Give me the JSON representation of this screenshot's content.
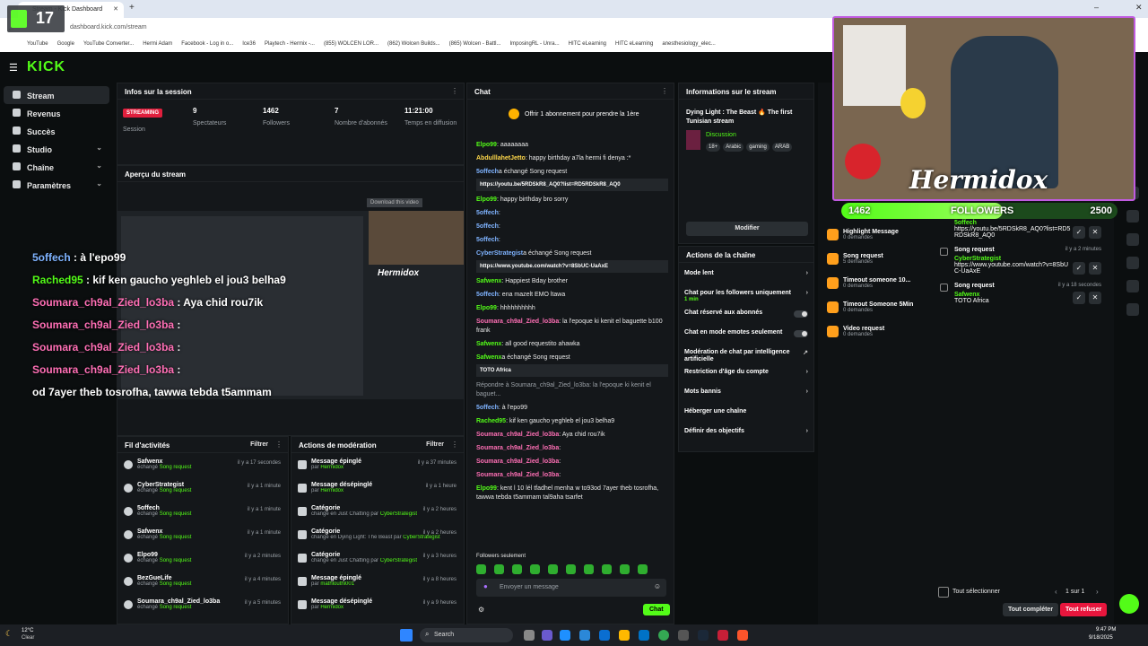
{
  "browser": {
    "tab_title": "Stream - Kick Dashboard",
    "url": "dashboard.kick.com/stream",
    "bookmarks": [
      "YouTube",
      "Google",
      "YouTube Converter...",
      "Hermi Adam",
      "Facebook - Log in o...",
      "Ice36",
      "Playtech - Hermix -...",
      "(855) WOLCEN LOR...",
      "(862) Wolcen Builds...",
      "(865) Wolcen - Battl...",
      "ImposingRL - Unra...",
      "HITC eLearning",
      "HITC eLearning",
      "anesthesiology_elec..."
    ]
  },
  "webcam_badge": "17",
  "sidebar": {
    "logo": "KICK",
    "items": [
      {
        "label": "Stream",
        "active": true
      },
      {
        "label": "Revenus"
      },
      {
        "label": "Succès"
      },
      {
        "label": "Studio",
        "chevron": true
      },
      {
        "label": "Chaîne",
        "chevron": true
      },
      {
        "label": "Paramètres",
        "chevron": true
      }
    ]
  },
  "session": {
    "title": "Infos sur la session",
    "status_badge": "STREAMING",
    "status_label": "Session",
    "stats": [
      {
        "value": "9",
        "label": "Spectateurs"
      },
      {
        "value": "1462",
        "label": "Followers"
      },
      {
        "value": "7",
        "label": "Nombre d'abonnés"
      },
      {
        "value": "11:21:00",
        "label": "Temps en diffusion"
      }
    ]
  },
  "preview": {
    "title": "Aperçu du stream",
    "download_label": "Download this video"
  },
  "overlay_chat": [
    {
      "user": "5offech",
      "text": ": à l'epo99",
      "color": "#7fb3ff"
    },
    {
      "user": "Rached95",
      "text": ": kif ken gaucho yeghleb el jou3 belha9",
      "color": "#53fc18"
    },
    {
      "user": "Soumara_ch9al_Zied_lo3ba",
      "text": ": Aya chid rou7ik",
      "color": "#ff6fb5"
    },
    {
      "user": "Soumara_ch9al_Zied_lo3ba",
      "text": ":",
      "color": "#ff6fb5"
    },
    {
      "user": "Soumara_ch9al_Zied_lo3ba",
      "text": ":",
      "color": "#ff6fb5"
    },
    {
      "user": "Soumara_ch9al_Zied_lo3ba",
      "text": ":",
      "color": "#ff6fb5"
    },
    {
      "user": "",
      "text": "od 7ayer theb tosrofha, tawwa tebda t5ammam",
      "color": "#ffffff"
    }
  ],
  "chat": {
    "title": "Chat",
    "sub_banner": "Offrir 1 abonnement pour prendre la 1ère",
    "messages": [
      {
        "user": "Elpo99",
        "text": ": aaaaaaaa",
        "color": "#53fc18"
      },
      {
        "user": "AbdulllahetJetto",
        "text": ": happy birthday a7la hermi fi denya :*",
        "color": "#ffd84a"
      },
      {
        "user": "5offech",
        "text": "a échangé Song request",
        "color": "#7fb3ff",
        "link": "https://youtu.be/5RDSkR8_AQ0?list=RD5RDSkR8_AQ0"
      },
      {
        "user": "Elpo99",
        "text": ": happy birthday bro sorry",
        "color": "#53fc18"
      },
      {
        "user": "5offech",
        "text": ":",
        "color": "#7fb3ff"
      },
      {
        "user": "5offech",
        "text": ":",
        "color": "#7fb3ff"
      },
      {
        "user": "5offech",
        "text": ":",
        "color": "#7fb3ff"
      },
      {
        "user": "CyberStrategist",
        "text": "a échangé Song request",
        "color": "#7fb3ff",
        "link": "https://www.youtube.com/watch?v=8SbUC-UaAxE"
      },
      {
        "user": "Safwenx",
        "text": ": Happiest Bday brother",
        "color": "#53fc18"
      },
      {
        "user": "5offech",
        "text": ": ena mazelt EMO ltawa",
        "color": "#7fb3ff"
      },
      {
        "user": "Elpo99",
        "text": ": hhhhhhhhhh",
        "color": "#53fc18"
      },
      {
        "user": "Soumara_ch9al_Zied_lo3ba",
        "text": ": la l'epoque ki kenit el baguette b100 frank",
        "color": "#ff6fb5"
      },
      {
        "user": "Safwenx",
        "text": ": all good requestito ahawka",
        "color": "#53fc18"
      },
      {
        "user": "Safwenx",
        "text": "a échangé Song request",
        "color": "#53fc18",
        "link": "TOTO Africa"
      },
      {
        "user": "",
        "text": "Répondre à Soumara_ch9al_Zied_lo3ba: la l'epoque ki kenit el baguet...",
        "color": "#9aa0a6"
      },
      {
        "user": "5offech",
        "text": ": à l'epo99",
        "color": "#7fb3ff"
      },
      {
        "user": "Rached95",
        "text": ": kif ken gaucho yeghleb el jou3 belha9",
        "color": "#53fc18"
      },
      {
        "user": "Soumara_ch9al_Zied_lo3ba",
        "text": ": Aya chid rou7ik",
        "color": "#ff6fb5"
      },
      {
        "user": "Soumara_ch9al_Zied_lo3ba",
        "text": ":",
        "color": "#ff6fb5"
      },
      {
        "user": "Soumara_ch9al_Zied_lo3ba",
        "text": ":",
        "color": "#ff6fb5"
      },
      {
        "user": "Soumara_ch9al_Zied_lo3ba",
        "text": ":",
        "color": "#ff6fb5"
      },
      {
        "user": "Elpo99",
        "text": ": kent l 10 lél tfadhel menha w to93od 7ayer theb tosrofha, tawwa tebda t5ammam tal9aha tsarfet",
        "color": "#53fc18"
      }
    ],
    "followers_only": "Followers seulement",
    "input_placeholder": "Envoyer un message",
    "send_label": "Chat"
  },
  "stream_info": {
    "title": "Informations sur le stream",
    "stream_title": "Dying Light : The Beast 🔥 The first Tunisian stream",
    "category": "Discussion",
    "tags": [
      "18+",
      "Arabic",
      "gaming",
      "ARAB"
    ],
    "modify_label": "Modifier"
  },
  "channel_actions": {
    "title": "Actions de la chaîne",
    "rows": [
      {
        "label": "Mode lent",
        "type": "chevron"
      },
      {
        "label": "Chat pour les followers uniquement",
        "sub": "1 min",
        "type": "chevron"
      },
      {
        "label": "Chat réservé aux abonnés",
        "type": "toggle"
      },
      {
        "label": "Chat en mode emotes seulement",
        "type": "toggle"
      },
      {
        "label": "Modération de chat par intelligence artificielle",
        "type": "link"
      },
      {
        "label": "Restriction d'âge du compte",
        "type": "chevron"
      },
      {
        "label": "Mots bannis",
        "type": "chevron"
      },
      {
        "label": "Héberger une chaîne",
        "type": "none"
      },
      {
        "label": "Définir des objectifs",
        "type": "chevron"
      }
    ]
  },
  "activity": {
    "title": "Fil d'activités",
    "filter_label": "Filtrer",
    "rows": [
      {
        "user": "Safwenx",
        "action": "échangé",
        "item": "Song request",
        "time": "il y a 17 secondes"
      },
      {
        "user": "CyberStrategist",
        "action": "échangé",
        "item": "Song request",
        "time": "il y a 1 minute"
      },
      {
        "user": "5offech",
        "action": "échangé",
        "item": "Song request",
        "time": "il y a 1 minute"
      },
      {
        "user": "Safwenx",
        "action": "échangé",
        "item": "Song request",
        "time": "il y a 1 minute"
      },
      {
        "user": "Elpo99",
        "action": "échangé",
        "item": "Song request",
        "time": "il y a 2 minutes"
      },
      {
        "user": "BezGueLife",
        "action": "échangé",
        "item": "Song request",
        "time": "il y a 4 minutes"
      },
      {
        "user": "Soumara_ch9al_Zied_lo3ba",
        "action": "échangé",
        "item": "Song request",
        "time": "il y a 5 minutes"
      }
    ]
  },
  "moderation": {
    "title": "Actions de modération",
    "filter_label": "Filtrer",
    "rows": [
      {
        "title": "Message épinglé",
        "detail": "par",
        "who": "Hermidox",
        "time": "il y a 37 minutes"
      },
      {
        "title": "Message désépinglé",
        "detail": "par",
        "who": "Hermidox",
        "time": "il y a 1 heure"
      },
      {
        "title": "Catégorie",
        "detail": "changé en Just Chatting par",
        "who": "CyberStrategist",
        "time": "il y a 2 heures"
      },
      {
        "title": "Catégorie",
        "detail": "changé en Dying Light: The Beast par",
        "who": "CyberStrategist",
        "time": "il y a 2 heures"
      },
      {
        "title": "Catégorie",
        "detail": "changé en Just Chatting par",
        "who": "CyberStrategist",
        "time": "il y a 3 heures"
      },
      {
        "title": "Message épinglé",
        "detail": "par",
        "who": "mathlouthi001",
        "time": "il y a 8 heures"
      },
      {
        "title": "Message désépinglé",
        "detail": "par",
        "who": "Hermidox",
        "time": "il y a 9 heures"
      }
    ]
  },
  "follower_goal": {
    "current": "1462",
    "label": "FOLLOWERS",
    "target": "2500",
    "progress": 0.585
  },
  "streamer_name": "Hermidox",
  "rewards": [
    {
      "label": "Highlight Message",
      "sub": "0 demandes"
    },
    {
      "label": "Song request",
      "sub": "5 demandes"
    },
    {
      "label": "Timeout someone 10...",
      "sub": "0 demandes"
    },
    {
      "label": "Timeout Someone 5Min",
      "sub": "0 demandes"
    },
    {
      "label": "Video request",
      "sub": "0 demandes"
    }
  ],
  "requests": [
    {
      "user": "5offech",
      "text": "https://youtu.be/5RDSkR8_AQ0?list=RD5RDSkR8_AQ0",
      "title": "",
      "time": ""
    },
    {
      "user": "CyberStrategist",
      "text": "https://www.youtube.com/watch?v=8SbUC-UaAxE",
      "title": "Song request",
      "time": "il y a 2 minutes"
    },
    {
      "user": "Safwenx",
      "text": "TOTO Africa",
      "title": "Song request",
      "time": "il y a 18 secondes"
    }
  ],
  "request_footer": {
    "select_all": "Tout sélectionner",
    "page": "1 sur 1",
    "complete_all": "Tout compléter",
    "refuse_all": "Tout refuser"
  },
  "taskbar": {
    "weather_temp": "12°C",
    "weather_desc": "Clear",
    "search_placeholder": "Search",
    "time": "9:47 PM",
    "date": "9/18/2025"
  },
  "colors": {
    "accent": "#53fc18",
    "streaming": "#e01f3d",
    "refuse": "#e8163d"
  }
}
